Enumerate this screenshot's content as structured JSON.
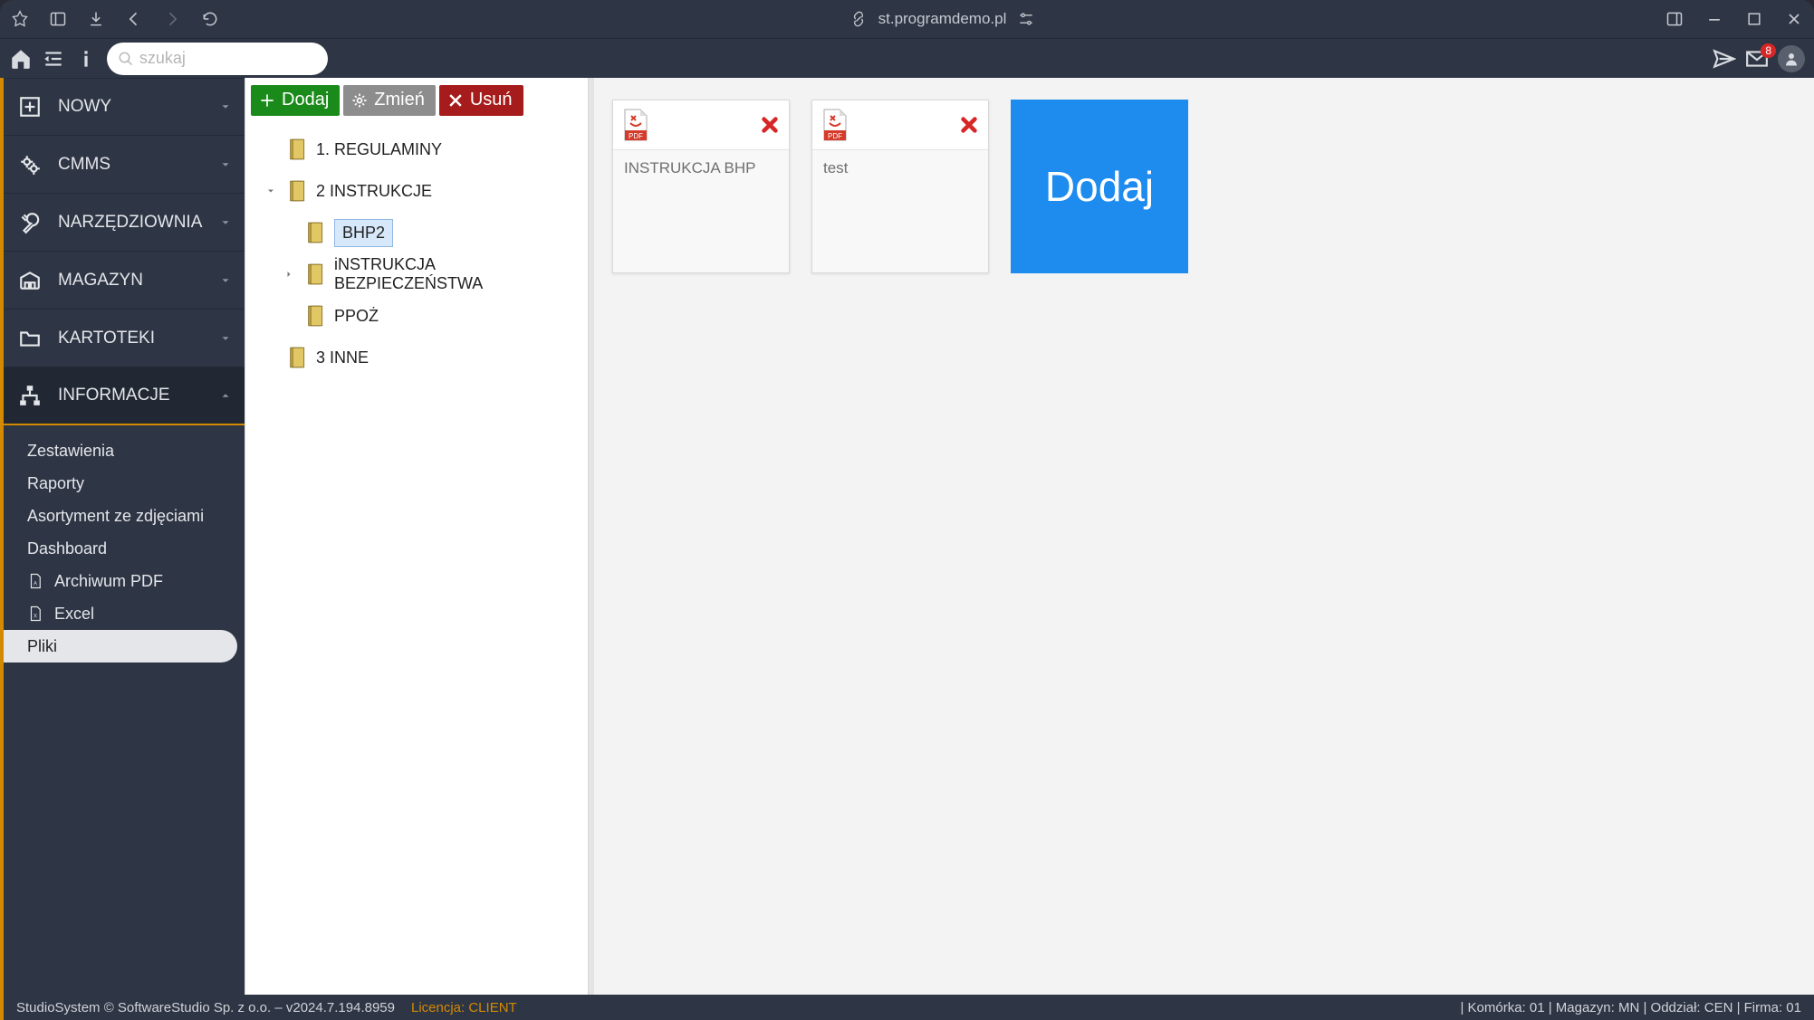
{
  "browser": {
    "url": "st.programdemo.pl"
  },
  "toolbar": {
    "search_placeholder": "szukaj",
    "mail_badge": "8"
  },
  "sidebar": {
    "items": [
      {
        "label": "NOWY"
      },
      {
        "label": "CMMS"
      },
      {
        "label": "NARZĘDZIOWNIA"
      },
      {
        "label": "MAGAZYN"
      },
      {
        "label": "KARTOTEKI"
      },
      {
        "label": "INFORMACJE"
      }
    ],
    "sub": {
      "zestawienia": "Zestawienia",
      "raporty": "Raporty",
      "asortyment": "Asortyment ze zdjęciami",
      "dashboard": "Dashboard",
      "archiwum": "Archiwum PDF",
      "excel": "Excel",
      "pliki": "Pliki"
    }
  },
  "tree": {
    "buttons": {
      "add": "Dodaj",
      "edit": "Zmień",
      "delete": "Usuń"
    },
    "nodes": {
      "n0": "1. REGULAMINY",
      "n1": "2 INSTRUKCJE",
      "n1a": "BHP2",
      "n1b": "iNSTRUKCJA BEZPIECZEŃSTWA",
      "n1c": "PPOŻ",
      "n2": "3 INNE"
    }
  },
  "files": [
    {
      "name": "INSTRUKCJA BHP"
    },
    {
      "name": "test"
    }
  ],
  "content": {
    "add_label": "Dodaj"
  },
  "status": {
    "left": "StudioSystem © SoftwareStudio Sp. z o.o. – v2024.7.194.8959",
    "license": "Licencja: CLIENT",
    "right": "| Komórka: 01 | Magazyn: MN | Oddział: CEN | Firma: 01"
  }
}
